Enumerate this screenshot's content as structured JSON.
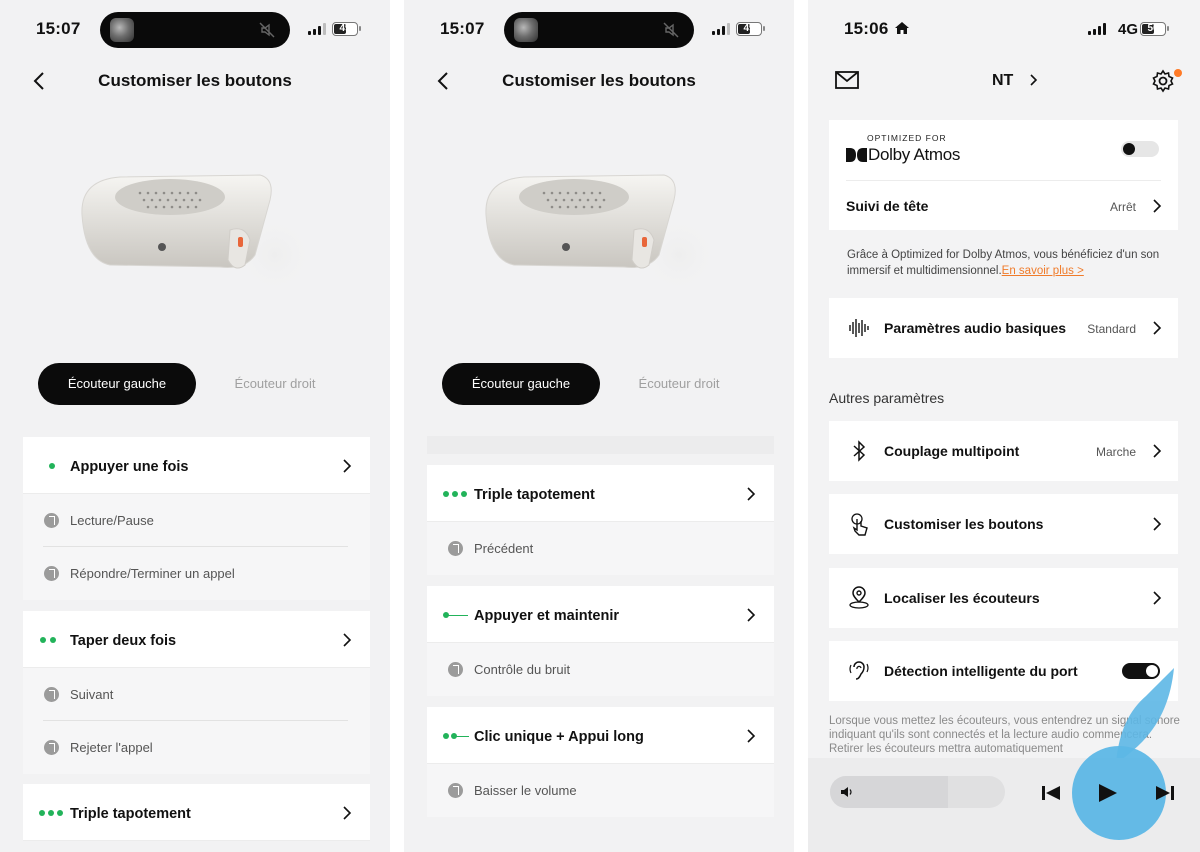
{
  "panel1": {
    "time": "15:07",
    "battery": "49",
    "title": "Customiser les boutons",
    "tabs": [
      "Écouteur gauche",
      "Écouteur droit"
    ],
    "groups": [
      {
        "label": "Appuyer une fois",
        "dots": 1,
        "items": [
          "Lecture/Pause",
          "Répondre/Terminer un appel"
        ]
      },
      {
        "label": "Taper deux fois",
        "dots": 2,
        "items": [
          "Suivant",
          "Rejeter l'appel"
        ]
      },
      {
        "label": "Triple tapotement",
        "dots": 3,
        "items": []
      }
    ]
  },
  "panel2": {
    "time": "15:07",
    "battery": "49",
    "title": "Customiser les boutons",
    "tabs": [
      "Écouteur gauche",
      "Écouteur droit"
    ],
    "groups": [
      {
        "label": "Triple tapotement",
        "items": [
          "Précédent"
        ]
      },
      {
        "label": "Appuyer et maintenir",
        "items": [
          "Contrôle du bruit"
        ]
      },
      {
        "label": "Clic unique + Appui long",
        "items": [
          "Baisser le volume"
        ]
      }
    ]
  },
  "panel3": {
    "time": "15:06",
    "network": "4G",
    "battery": "50",
    "device_name": "NT",
    "dolby": {
      "tagline": "OPTIMIZED FOR",
      "brand": "Dolby Atmos",
      "toggle_on": false,
      "head_tracking_label": "Suivi de tête",
      "head_tracking_value": "Arrêt",
      "description": "Grâce à Optimized for Dolby Atmos, vous bénéficiez d'un son immersif et multidimensionnel.",
      "learn_more": "En savoir plus >"
    },
    "audio": {
      "label": "Paramètres audio basiques",
      "value": "Standard"
    },
    "section_title": "Autres paramètres",
    "rows": [
      {
        "label": "Couplage multipoint",
        "value": "Marche",
        "icon": "bluetooth-icon"
      },
      {
        "label": "Customiser les boutons",
        "value": "",
        "icon": "touch-icon"
      },
      {
        "label": "Localiser les écouteurs",
        "value": "",
        "icon": "location-icon"
      },
      {
        "label": "Détection intelligente du port",
        "value": "",
        "icon": "ear-icon",
        "toggle_on": true
      }
    ],
    "wear_description": "Lorsque vous mettez les écouteurs, vous entendrez un signal sonore indiquant qu'ils sont connectés et la lecture audio commencera. Retirer les écouteurs mettra automatiquement",
    "accent_color": "#5db7e6",
    "link_color": "#f07b2a",
    "dot_color": "#22b35a"
  }
}
